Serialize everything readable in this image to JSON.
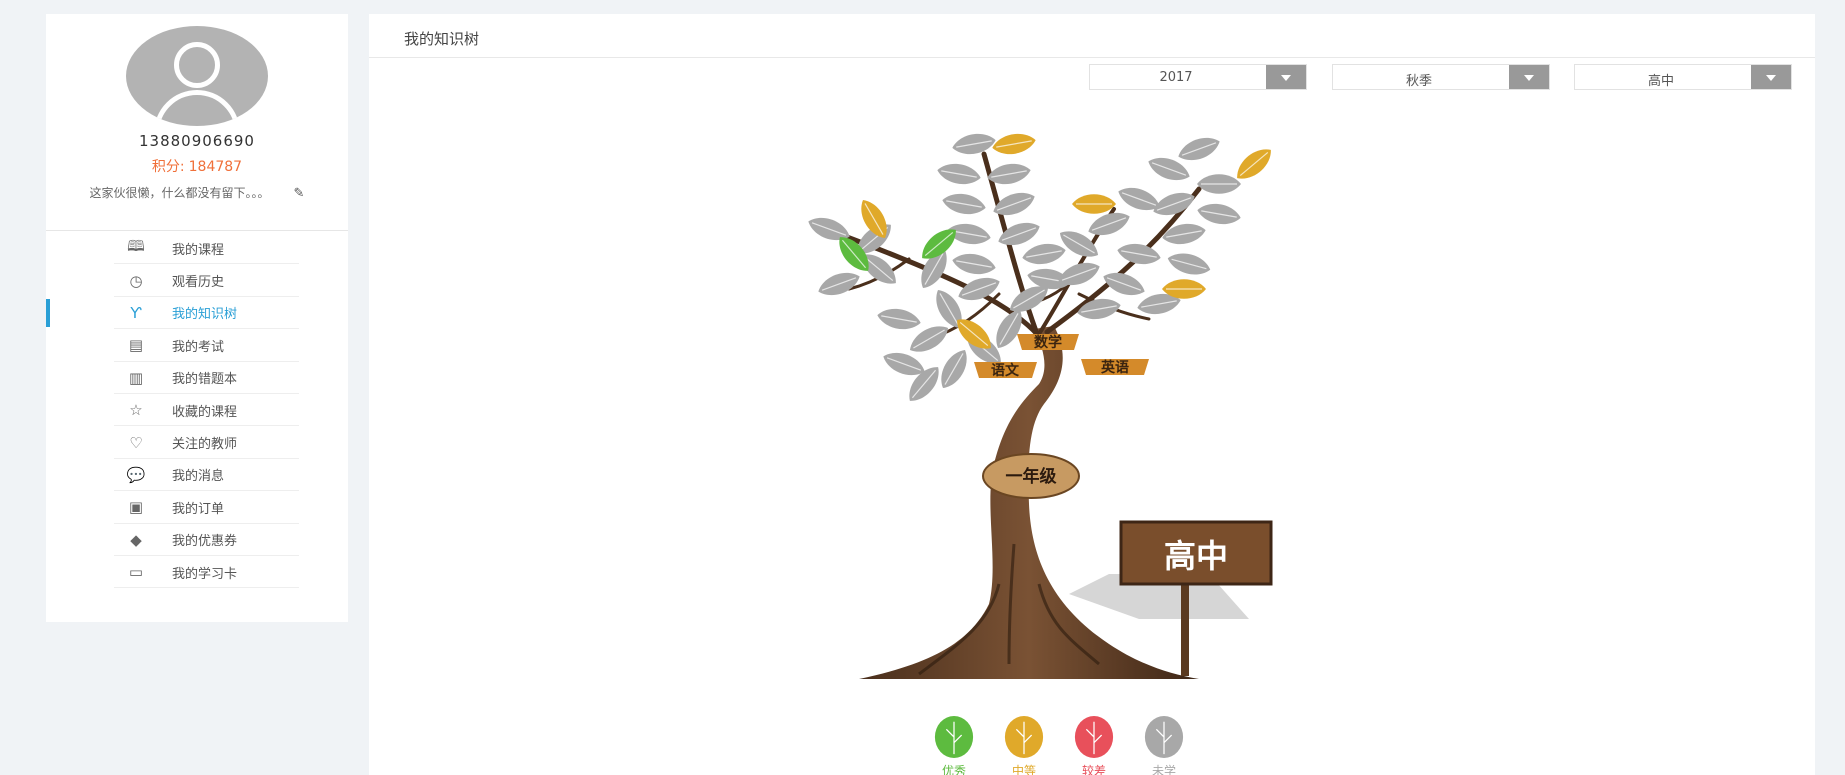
{
  "profile": {
    "phone": "13880906690",
    "points_label": "积分:",
    "points_value": "184787",
    "signature": "这家伙很懒，什么都没有留下。。。"
  },
  "menu": [
    {
      "label": "我的课程",
      "icon": "book-icon"
    },
    {
      "label": "观看历史",
      "icon": "clock-icon"
    },
    {
      "label": "我的知识树",
      "icon": "tree-icon",
      "active": true
    },
    {
      "label": "我的考试",
      "icon": "exam-icon"
    },
    {
      "label": "我的错题本",
      "icon": "notebook-icon"
    },
    {
      "label": "收藏的课程",
      "icon": "star-icon"
    },
    {
      "label": "关注的教师",
      "icon": "heart-icon"
    },
    {
      "label": "我的消息",
      "icon": "message-icon"
    },
    {
      "label": "我的订单",
      "icon": "order-icon"
    },
    {
      "label": "我的优惠券",
      "icon": "coupon-icon"
    },
    {
      "label": "我的学习卡",
      "icon": "card-icon"
    }
  ],
  "main": {
    "title": "我的知识树",
    "filters": {
      "year": "2017",
      "season": "秋季",
      "level": "高中"
    }
  },
  "tree": {
    "subjects": [
      "数学",
      "语文",
      "英语"
    ],
    "grade_sign": "一年级",
    "level_sign": "高中"
  },
  "legend": [
    {
      "label": "优秀",
      "color": "#5dbb3f"
    },
    {
      "label": "中等",
      "color": "#e0a92a"
    },
    {
      "label": "较差",
      "color": "#e8505b"
    },
    {
      "label": "未学",
      "color": "#a8a8a8"
    }
  ],
  "colors": {
    "accent": "#2a9fd6",
    "points": "#f0703a",
    "leaf_unlearned": "#a8a8a8",
    "leaf_medium": "#e0a92a",
    "leaf_good": "#5dbb3f"
  }
}
